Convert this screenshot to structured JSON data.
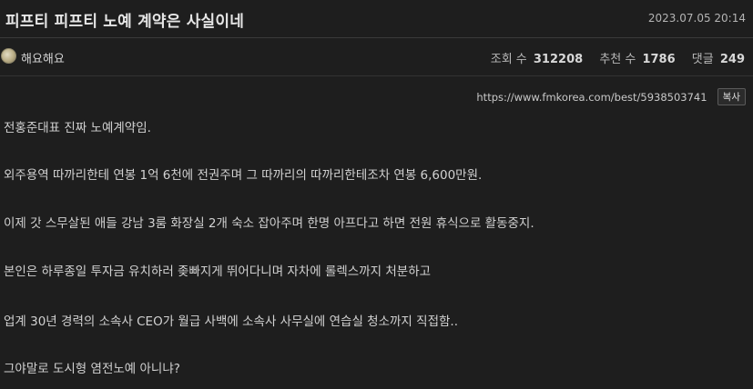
{
  "post": {
    "title": "피프티 피프티 노예 계약은 사실이네",
    "date": "2023.07.05 20:14"
  },
  "meta": {
    "author": "해요해요",
    "avatar_icon": "avatar-image",
    "views_label": "조회 수",
    "views_value": "312208",
    "recommend_label": "추천 수",
    "recommend_value": "1786",
    "comments_label": "댓글",
    "comments_value": "249"
  },
  "link": {
    "url": "https://www.fmkorea.com/best/5938503741",
    "copy_label": "복사"
  },
  "content": {
    "paragraphs": [
      "전홍준대표 진짜 노예계약임.",
      "외주용역 따까리한테 연봉 1억 6천에 전권주며 그 따까리의 따까리한테조차 연봉 6,600만원.",
      "이제 갓 스무살된 애들 강남 3룸 화장실 2개 숙소 잡아주며 한명 아프다고 하면 전원 휴식으로 활동중지.",
      "본인은 하루종일 투자금 유치하러 좆빠지게 뛰어다니며 자차에 롤렉스까지 처분하고",
      "업계 30년 경력의 소속사 CEO가 월급 사백에 소속사 사무실에 연습실 청소까지 직접함..",
      "그야말로 도시형 염전노예 아니냐?"
    ]
  },
  "colors": {
    "background": "#1e1e1e",
    "divider": "#3a3a3a",
    "text": "#d2d2d2"
  }
}
